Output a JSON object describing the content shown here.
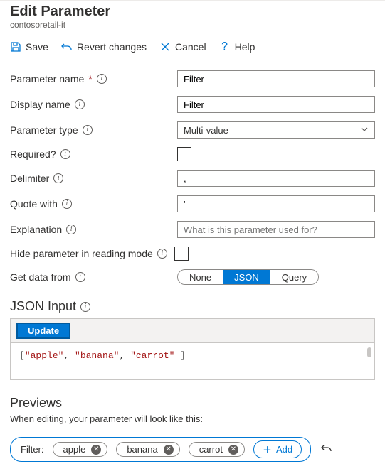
{
  "header": {
    "title": "Edit Parameter",
    "subtitle": "contosoretail-it"
  },
  "toolbar": {
    "save": "Save",
    "revert": "Revert changes",
    "cancel": "Cancel",
    "help": "Help"
  },
  "labels": {
    "parameter_name": "Parameter name",
    "display_name": "Display name",
    "parameter_type": "Parameter type",
    "required": "Required?",
    "delimiter": "Delimiter",
    "quote_with": "Quote with",
    "explanation": "Explanation",
    "hide_param": "Hide parameter in reading mode",
    "get_data_from": "Get data from"
  },
  "fields": {
    "parameter_name": "Filter",
    "display_name": "Filter",
    "parameter_type": "Multi-value",
    "delimiter": ",",
    "quote_with": "'",
    "explanation_placeholder": "What is this parameter used for?"
  },
  "data_source": {
    "options": {
      "none": "None",
      "json": "JSON",
      "query": "Query"
    },
    "selected": "json"
  },
  "json_section": {
    "heading": "JSON Input",
    "update": "Update",
    "code_prefix": "[",
    "code_s1": "\"apple\"",
    "code_c1": ", ",
    "code_s2": "\"banana\"",
    "code_c2": ", ",
    "code_s3": "\"carrot\"",
    "code_suffix": " ]"
  },
  "previews": {
    "heading": "Previews",
    "subtext": "When editing, your parameter will look like this:",
    "filter_label": "Filter:",
    "chips": [
      "apple",
      "banana",
      "carrot"
    ],
    "add": "Add"
  }
}
